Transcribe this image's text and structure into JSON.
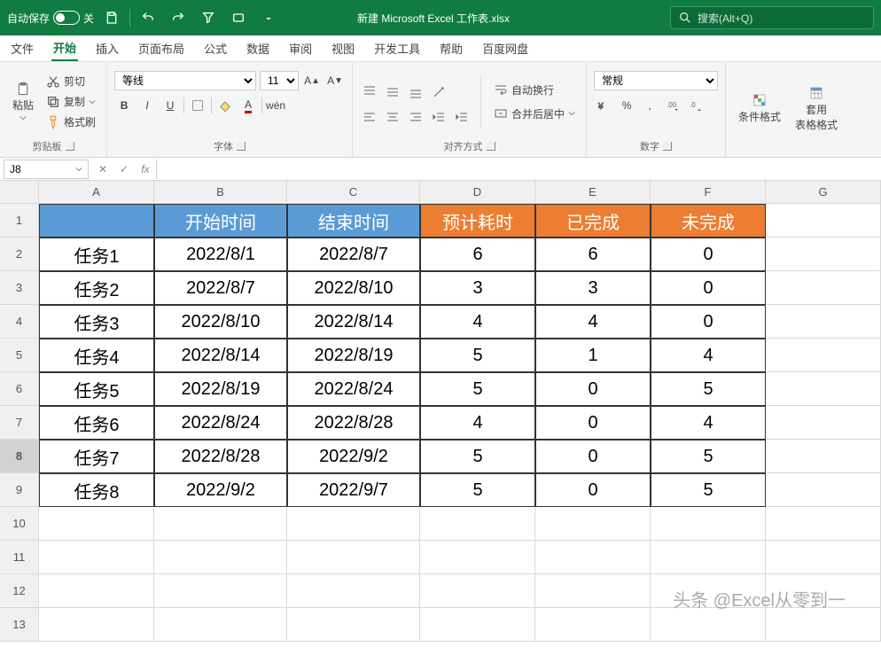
{
  "titlebar": {
    "autosave_label": "自动保存",
    "autosave_state": "关",
    "filename": "新建 Microsoft Excel 工作表.xlsx",
    "search_placeholder": "搜索(Alt+Q)"
  },
  "menutabs": [
    "文件",
    "开始",
    "插入",
    "页面布局",
    "公式",
    "数据",
    "审阅",
    "视图",
    "开发工具",
    "帮助",
    "百度网盘"
  ],
  "menutabs_active": 1,
  "ribbon": {
    "clipboard": {
      "paste": "粘贴",
      "cut": "剪切",
      "copy": "复制",
      "format_painter": "格式刷",
      "label": "剪贴板"
    },
    "font": {
      "name": "等线",
      "size": "11",
      "bold": "B",
      "italic": "I",
      "underline": "U",
      "label": "字体",
      "ruby": "wén"
    },
    "align": {
      "wrap": "自动换行",
      "merge": "合并后居中",
      "label": "对齐方式"
    },
    "number": {
      "format": "常规",
      "label": "数字"
    },
    "styles": {
      "conditional": "条件格式",
      "table_format": "套用\n表格格式"
    }
  },
  "namebox": "J8",
  "columns": [
    "A",
    "B",
    "C",
    "D",
    "E",
    "F",
    "G"
  ],
  "chart_data": {
    "type": "table",
    "headers": [
      "",
      "开始时间",
      "结束时间",
      "预计耗时",
      "已完成",
      "未完成"
    ],
    "header_colors": [
      "#5b9bd5",
      "#5b9bd5",
      "#5b9bd5",
      "#ed7d31",
      "#ed7d31",
      "#ed7d31"
    ],
    "rows": [
      [
        "任务1",
        "2022/8/1",
        "2022/8/7",
        "6",
        "6",
        "0"
      ],
      [
        "任务2",
        "2022/8/7",
        "2022/8/10",
        "3",
        "3",
        "0"
      ],
      [
        "任务3",
        "2022/8/10",
        "2022/8/14",
        "4",
        "4",
        "0"
      ],
      [
        "任务4",
        "2022/8/14",
        "2022/8/19",
        "5",
        "1",
        "4"
      ],
      [
        "任务5",
        "2022/8/19",
        "2022/8/24",
        "5",
        "0",
        "5"
      ],
      [
        "任务6",
        "2022/8/24",
        "2022/8/28",
        "4",
        "0",
        "4"
      ],
      [
        "任务7",
        "2022/8/28",
        "2022/9/2",
        "5",
        "0",
        "5"
      ],
      [
        "任务8",
        "2022/9/2",
        "2022/9/7",
        "5",
        "0",
        "5"
      ]
    ]
  },
  "selected_row": 8,
  "watermark": "头条 @Excel从零到一"
}
